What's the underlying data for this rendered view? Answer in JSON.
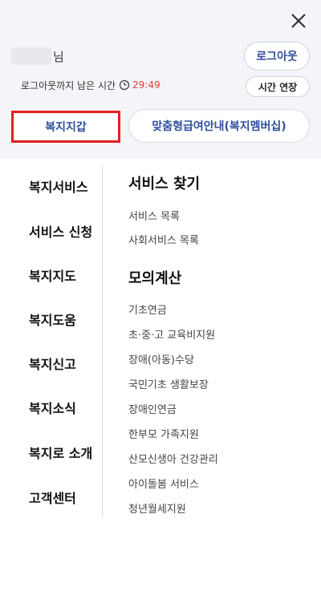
{
  "header": {
    "close_icon": "close-icon",
    "user_suffix": "님",
    "logout_label": "로그아웃",
    "timer_label": "로그아웃까지 남은 시간",
    "timer_value": "29:49",
    "clock_icon": "clock-icon",
    "extend_label": "시간 연장",
    "wallet_label": "복지지갑",
    "member_label": "맞춤형급여안내(복지멤버십)"
  },
  "nav": {
    "items": [
      {
        "label": "복지서비스"
      },
      {
        "label": "서비스 신청"
      },
      {
        "label": "복지지도"
      },
      {
        "label": "복지도움"
      },
      {
        "label": "복지신고"
      },
      {
        "label": "복지소식"
      },
      {
        "label": "복지로 소개"
      },
      {
        "label": "고객센터"
      }
    ]
  },
  "content": {
    "sections": [
      {
        "title": "서비스 찾기",
        "links": [
          "서비스 목록",
          "사회서비스 목록"
        ]
      },
      {
        "title": "모의계산",
        "links": [
          "기초연금",
          "초·중·고 교육비지원",
          "장애(아동)수당",
          "국민기초 생활보장",
          "장애인연금",
          "한부모 가족지원",
          "산모신생아 건강관리",
          "아이돌봄 서비스",
          "청년월세지원"
        ]
      }
    ]
  },
  "colors": {
    "accent_blue": "#2f4f9d",
    "highlight_red": "#e21f1f",
    "timer_red": "#e53935",
    "panel_bg": "#f3f5f8"
  }
}
